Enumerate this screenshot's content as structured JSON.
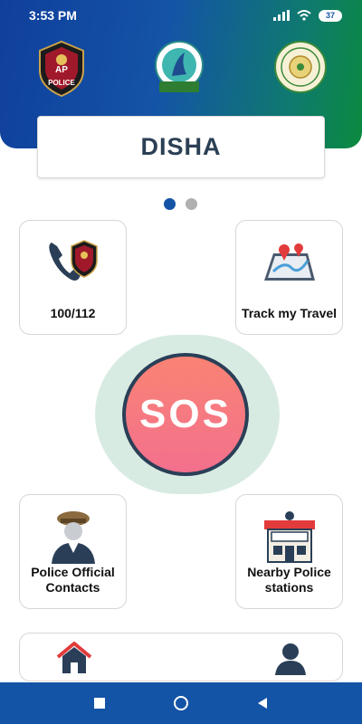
{
  "status_bar": {
    "time": "3:53 PM",
    "battery_level": "37"
  },
  "header": {
    "logos": [
      {
        "icon": "ap-police-logo",
        "text": "POLICE"
      },
      {
        "icon": "disha-logo",
        "text": ""
      },
      {
        "icon": "government-seal-logo",
        "text": ""
      }
    ],
    "app_title": "DISHA"
  },
  "carousel": {
    "dot_count": 2,
    "active_index": 0
  },
  "tiles": {
    "emergency_call": {
      "label": "100/112",
      "icon": "phone-police-icon"
    },
    "track_travel": {
      "label": "Track my Travel",
      "icon": "map-location-icon"
    },
    "police_contacts": {
      "label": "Police Official Contacts",
      "icon": "police-officer-icon"
    },
    "nearby_stations": {
      "label": "Nearby Police stations",
      "icon": "police-station-icon"
    }
  },
  "sos": {
    "label": "SOS",
    "color_top": "#f98374",
    "color_bottom": "#f3708d"
  },
  "bottom_nav": {
    "home_icon": "home-icon",
    "profile_icon": "profile-icon"
  },
  "colors": {
    "primary_blue": "#1454a6",
    "primary_green": "#0b8a3e",
    "title_text": "#2b3f55"
  }
}
